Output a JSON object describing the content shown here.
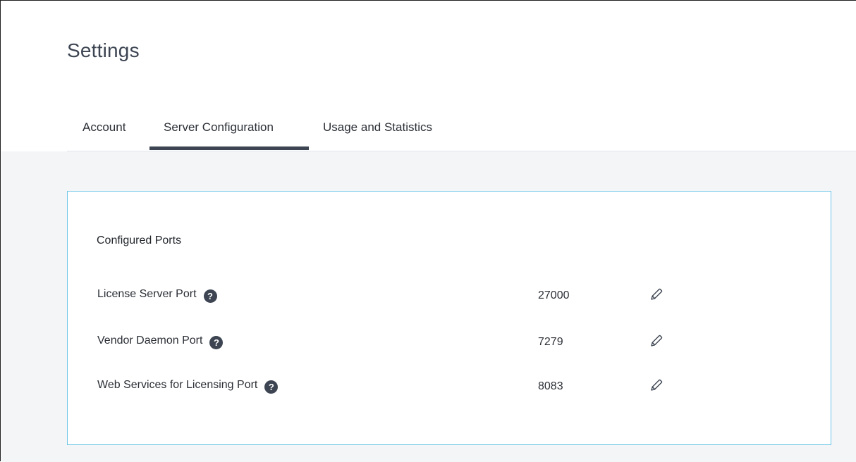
{
  "page": {
    "title": "Settings"
  },
  "tabs": [
    {
      "label": "Account",
      "active": false
    },
    {
      "label": "Server Configuration",
      "active": true
    },
    {
      "label": "Usage and Statistics",
      "active": false
    }
  ],
  "card": {
    "title": "Configured Ports",
    "ports": [
      {
        "label": "License Server Port",
        "value": "27000",
        "help_icon": "question-circle-icon",
        "edit_icon": "pencil-icon"
      },
      {
        "label": "Vendor Daemon Port",
        "value": "7279",
        "help_icon": "question-circle-icon",
        "edit_icon": "pencil-icon"
      },
      {
        "label": "Web Services for Licensing Port",
        "value": "8083",
        "help_icon": "question-circle-icon",
        "edit_icon": "pencil-icon"
      }
    ]
  },
  "icons": {
    "help_glyph": "?"
  },
  "colors": {
    "accent_underline": "#3d4552",
    "card_border": "#6cc5e8",
    "content_background": "#f4f5f7"
  }
}
